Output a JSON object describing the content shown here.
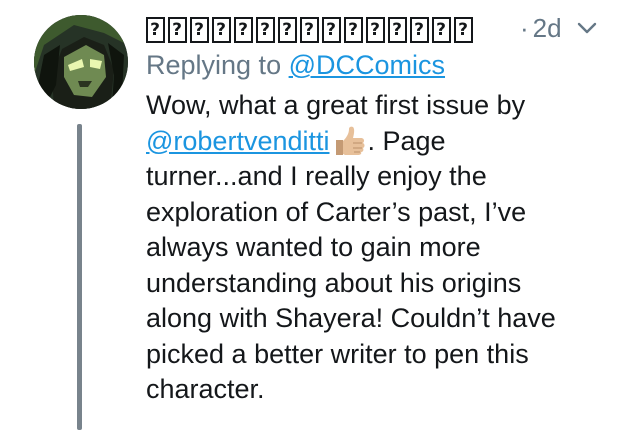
{
  "tweet": {
    "display_name_glyphs": [
      "?",
      "?",
      "?",
      "?",
      "?",
      "?",
      "?",
      "?",
      "?",
      "?",
      "?",
      "?",
      "?",
      "?",
      "?"
    ],
    "separator": "·",
    "timestamp": "2d",
    "replying_prefix": "Replying to ",
    "replying_handle": "@DCComics",
    "body": {
      "line1": "Wow, what a great first issue by",
      "mention": "@robertvenditti",
      "emoji": "thumbs-up-emoji",
      "line2_rest": ". Page",
      "line3": "turner...and I really enjoy the",
      "line4": "exploration of Carter’s past, I’ve",
      "line5": "always wanted to gain more",
      "line6": "understanding about his origins",
      "line7": "along with Shayera! Couldn’t have",
      "line8": "picked a better writer to pen this",
      "line9": "character."
    }
  },
  "icons": {
    "menu": "chevron-down-icon",
    "avatar": "avatar-image"
  },
  "colors": {
    "link": "#1b95e0",
    "muted": "#657786",
    "text": "#14171a",
    "thread_line": "#78838c"
  }
}
